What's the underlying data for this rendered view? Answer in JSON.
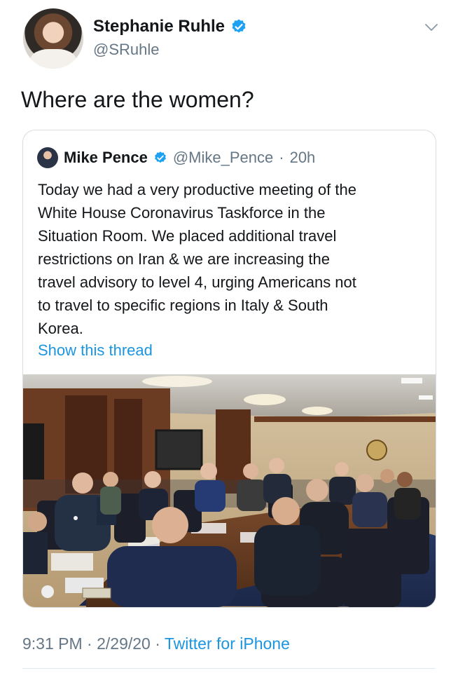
{
  "author": {
    "name": "Stephanie Ruhle",
    "handle": "@SRuhle",
    "verified": true,
    "avatar": "author-avatar-photo"
  },
  "tweet": {
    "text": "Where are the women?"
  },
  "quoted_tweet": {
    "name": "Mike Pence",
    "handle": "@Mike_Pence",
    "separator": "·",
    "time": "20h",
    "verified": true,
    "text_lines": [
      "Today we had a very productive meeting of the",
      "White House Coronavirus Taskforce in the",
      "Situation Room. We placed additional travel",
      "restrictions on Iran & we are increasing the",
      "travel advisory to level 4, urging Americans not",
      "to travel to specific regions in Italy & South",
      "Korea."
    ],
    "show_thread": "Show this thread",
    "image": "situation-room-meeting-photo"
  },
  "footer": {
    "time": "9:31 PM",
    "sep1": "·",
    "date": "2/29/20",
    "sep2": "·",
    "client": "Twitter for iPhone"
  },
  "colors": {
    "link": "#1b95e0",
    "secondary_text": "#657786",
    "verified_badge": "#1da1f2",
    "border": "#d9dde1"
  }
}
